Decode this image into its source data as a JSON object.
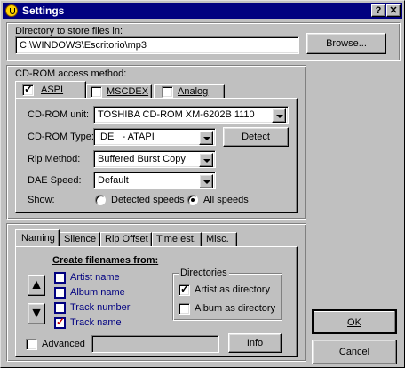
{
  "window": {
    "title": "Settings",
    "help_label": "?",
    "close_label": "✕"
  },
  "directory": {
    "label": "Directory to store files in:",
    "value": "C:\\WINDOWS\\Escritorio\\mp3",
    "browse_label": "Browse..."
  },
  "cdrom": {
    "group_label": "CD-ROM access method:",
    "tabs": [
      {
        "label": "ASPI",
        "checked": true
      },
      {
        "label": "MSCDEX",
        "checked": false
      },
      {
        "label": "Analog",
        "checked": false
      }
    ],
    "unit_label": "CD-ROM unit:",
    "unit_value": "TOSHIBA CD-ROM XM-6202B 1110",
    "type_label": "CD-ROM Type:",
    "type_value": "IDE   - ATAPI",
    "detect_label": "Detect",
    "rip_label": "Rip Method:",
    "rip_value": "Buffered Burst Copy",
    "dae_label": "DAE Speed:",
    "dae_value": "Default",
    "show_label": "Show:",
    "show_options": [
      {
        "label": "Detected speeds",
        "selected": false
      },
      {
        "label": "All speeds",
        "selected": true
      }
    ]
  },
  "naming": {
    "tabs": [
      "Naming",
      "Silence",
      "Rip Offset",
      "Time est.",
      "Misc."
    ],
    "create_label": "Create filenames from:",
    "up_arrow": "▲",
    "down_arrow": "▼",
    "fields": [
      {
        "label": "Artist name",
        "checked": false
      },
      {
        "label": "Album name",
        "checked": false
      },
      {
        "label": "Track number",
        "checked": false
      },
      {
        "label": "Track name",
        "checked": true
      }
    ],
    "directories_label": "Directories",
    "directories": [
      {
        "label": "Artist as directory",
        "checked": true
      },
      {
        "label": "Album as directory",
        "checked": false
      }
    ],
    "advanced_label": "Advanced",
    "advanced_value": "",
    "info_label": "Info"
  },
  "buttons": {
    "ok_label": "OK",
    "cancel_label": "Cancel"
  }
}
